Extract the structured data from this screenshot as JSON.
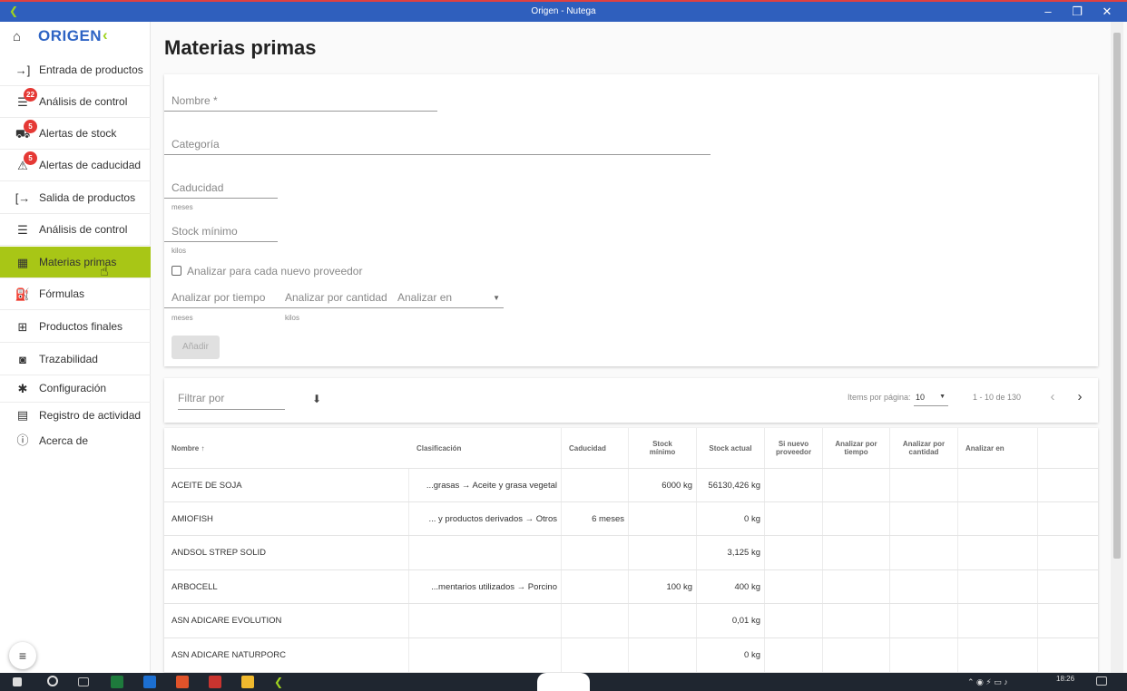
{
  "window": {
    "title": "Origen - Nutega",
    "minimize": "–",
    "maximize": "❐",
    "close": "✕"
  },
  "brand": {
    "name": "ORIGEN",
    "mark": "‹"
  },
  "sidebar": {
    "items": [
      {
        "label": "Entrada de productos",
        "icon": "→]"
      },
      {
        "label": "Análisis de control",
        "icon": "☰",
        "badge": "22"
      },
      {
        "label": "Alertas de stock",
        "icon": "⛟",
        "badge": "5"
      },
      {
        "label": "Alertas de caducidad",
        "icon": "⚠",
        "badge": "5"
      },
      {
        "label": "Salida de productos",
        "icon": "[→"
      },
      {
        "label": "Análisis de control",
        "icon": "☰"
      },
      {
        "label": "Materias primas",
        "icon": "▦"
      },
      {
        "label": "Fórmulas",
        "icon": "⛽"
      },
      {
        "label": "Productos finales",
        "icon": "⊞"
      },
      {
        "label": "Trazabilidad",
        "icon": "◙"
      },
      {
        "label": "Configuración",
        "icon": "✱"
      },
      {
        "label": "Registro de actividad",
        "icon": "▤"
      },
      {
        "label": "Acerca de",
        "icon": "ⓘ"
      }
    ],
    "menu_icon": "≡"
  },
  "page": {
    "title": "Materias primas"
  },
  "form": {
    "nombre": "Nombre *",
    "categoria": "Categoría",
    "caducidad": "Caducidad",
    "caducidad_hint": "meses",
    "stock_minimo": "Stock mínimo",
    "stock_minimo_hint": "kilos",
    "checkbox_label": "Analizar para cada nuevo proveedor",
    "analizar_tiempo": "Analizar por tiempo",
    "analizar_tiempo_hint": "meses",
    "analizar_cantidad": "Analizar por cantidad",
    "analizar_cantidad_hint": "kilos",
    "analizar_en": "Analizar en",
    "add_button": "Añadir"
  },
  "filter": {
    "placeholder": "Filtrar por",
    "per_page_label": "Items por página:",
    "per_page_value": "10",
    "range": "1 - 10 de 130",
    "prev": "‹",
    "next": "›"
  },
  "table": {
    "headers": [
      "Nombre ↑",
      "Clasificación",
      "Caducidad",
      "Stock mínimo",
      "Stock actual",
      "Si nuevo proveedor",
      "Analizar por tiempo",
      "Analizar por cantidad",
      "Analizar en"
    ],
    "rows": [
      {
        "nombre": "ACEITE DE SOJA",
        "clasificacion": "...grasas → Aceite y grasa vegetal",
        "caducidad": "",
        "stock_minimo": "6000 kg",
        "stock_actual": "56130,426 kg"
      },
      {
        "nombre": "AMIOFISH",
        "clasificacion": "... y productos derivados → Otros",
        "caducidad": "6 meses",
        "stock_minimo": "",
        "stock_actual": "0 kg"
      },
      {
        "nombre": "ANDSOL STREP SOLID",
        "clasificacion": "",
        "caducidad": "",
        "stock_minimo": "",
        "stock_actual": "3,125 kg"
      },
      {
        "nombre": "ARBOCELL",
        "clasificacion": "...mentarios utilizados → Porcino",
        "caducidad": "",
        "stock_minimo": "100 kg",
        "stock_actual": "400 kg"
      },
      {
        "nombre": "ASN ADICARE EVOLUTION",
        "clasificacion": "",
        "caducidad": "",
        "stock_minimo": "",
        "stock_actual": "0,01 kg"
      },
      {
        "nombre": "ASN ADICARE NATURPORC",
        "clasificacion": "",
        "caducidad": "",
        "stock_minimo": "",
        "stock_actual": "0 kg"
      }
    ]
  },
  "taskbar": {
    "time": "18:26"
  }
}
